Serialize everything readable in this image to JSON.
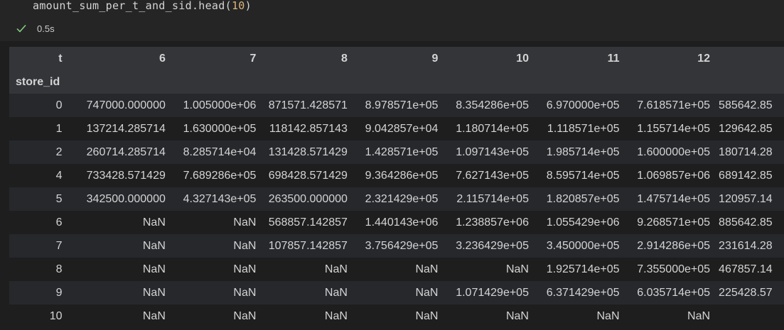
{
  "cell": {
    "code_prefix": "amount_sum_per_t_and_sid.head(",
    "code_arg": "10",
    "code_suffix": ")",
    "exec_time": "0.5s"
  },
  "table": {
    "column_axis_name": "t",
    "index_name": "store_id",
    "columns": [
      "6",
      "7",
      "8",
      "9",
      "10",
      "11",
      "12",
      ""
    ],
    "rows": [
      {
        "index": "0",
        "values": [
          "747000.000000",
          "1.005000e+06",
          "871571.428571",
          "8.978571e+05",
          "8.354286e+05",
          "6.970000e+05",
          "7.618571e+05",
          "585642.85"
        ]
      },
      {
        "index": "1",
        "values": [
          "137214.285714",
          "1.630000e+05",
          "118142.857143",
          "9.042857e+04",
          "1.180714e+05",
          "1.118571e+05",
          "1.155714e+05",
          "129642.85"
        ]
      },
      {
        "index": "2",
        "values": [
          "260714.285714",
          "8.285714e+04",
          "131428.571429",
          "1.428571e+05",
          "1.097143e+05",
          "1.985714e+05",
          "1.600000e+05",
          "180714.28"
        ]
      },
      {
        "index": "4",
        "values": [
          "733428.571429",
          "7.689286e+05",
          "698428.571429",
          "9.364286e+05",
          "7.627143e+05",
          "8.595714e+05",
          "1.069857e+06",
          "689142.85"
        ]
      },
      {
        "index": "5",
        "values": [
          "342500.000000",
          "4.327143e+05",
          "263500.000000",
          "2.321429e+05",
          "2.115714e+05",
          "1.820857e+05",
          "1.475714e+05",
          "120957.14"
        ]
      },
      {
        "index": "6",
        "values": [
          "NaN",
          "NaN",
          "568857.142857",
          "1.440143e+06",
          "1.238857e+06",
          "1.055429e+06",
          "9.268571e+05",
          "885642.85"
        ]
      },
      {
        "index": "7",
        "values": [
          "NaN",
          "NaN",
          "107857.142857",
          "3.756429e+05",
          "3.236429e+05",
          "3.450000e+05",
          "2.914286e+05",
          "231614.28"
        ]
      },
      {
        "index": "8",
        "values": [
          "NaN",
          "NaN",
          "NaN",
          "NaN",
          "NaN",
          "1.925714e+05",
          "7.355000e+05",
          "467857.14"
        ]
      },
      {
        "index": "9",
        "values": [
          "NaN",
          "NaN",
          "NaN",
          "NaN",
          "1.071429e+05",
          "6.371429e+05",
          "6.035714e+05",
          "225428.57"
        ]
      },
      {
        "index": "10",
        "values": [
          "NaN",
          "NaN",
          "NaN",
          "NaN",
          "NaN",
          "NaN",
          "NaN",
          ""
        ]
      }
    ]
  }
}
